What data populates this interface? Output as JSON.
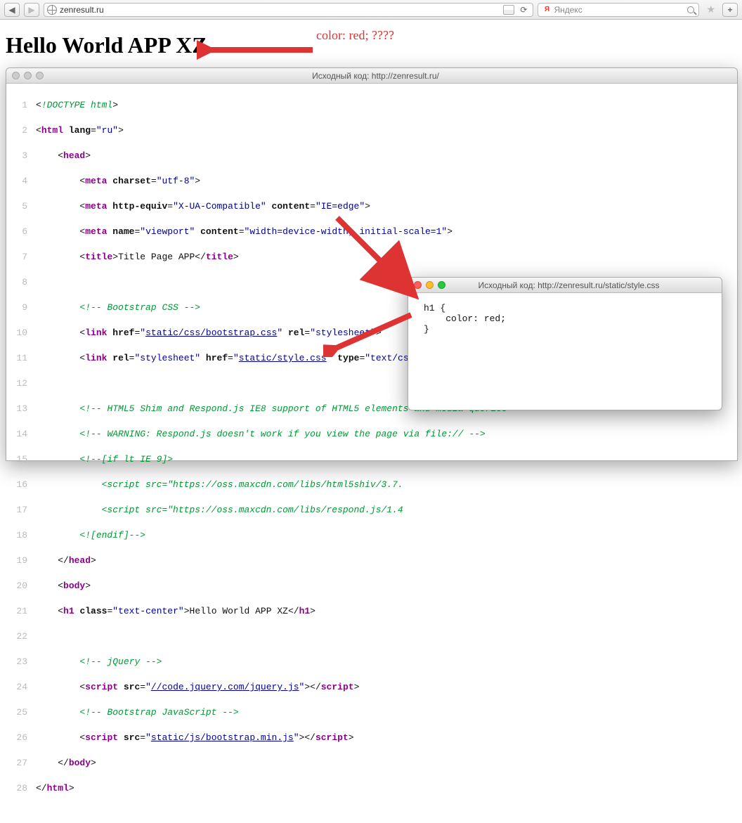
{
  "browser": {
    "url": "zenresult.ru",
    "search_placeholder": "Яндекс",
    "ya_glyph": "Я"
  },
  "page": {
    "heading": "Hello World APP XZ",
    "annotation": "color: red; ????"
  },
  "src_window": {
    "title": "Исходный код: http://zenresult.ru/"
  },
  "css_window": {
    "title": "Исходный код: http://zenresult.ru/static/style.css",
    "content": "h1 {\n    color: red;\n}"
  },
  "code": {
    "l1_com": "!DOCTYPE html",
    "l2_tag": "html",
    "l2_attr": "lang",
    "l2_val": "\"ru\"",
    "l3_tag": "head",
    "l4_tag": "meta",
    "l4_a1": "charset",
    "l4_v1": "\"utf-8\"",
    "l5_tag": "meta",
    "l5_a1": "http-equiv",
    "l5_v1": "\"X-UA-Compatible\"",
    "l5_a2": "content",
    "l5_v2": "\"IE=edge\"",
    "l6_tag": "meta",
    "l6_a1": "name",
    "l6_v1": "\"viewport\"",
    "l6_a2": "content",
    "l6_v2": "\"width=device-width, initial-scale=1\"",
    "l7_tag": "title",
    "l7_text": "Title Page APP",
    "l9_com": " Bootstrap CSS ",
    "l10_tag": "link",
    "l10_a1": "href",
    "l10_v1": "static/css/bootstrap.css",
    "l10_a2": "rel",
    "l10_v2": "\"stylesheet\"",
    "l11_tag": "link",
    "l11_a1": "rel",
    "l11_v1": "\"stylesheet\"",
    "l11_a2": "href",
    "l11_v2": "static/style.css",
    "l11_a3": "type",
    "l11_v3": "\"text/css\"",
    "l13_com": " HTML5 Shim and Respond.js IE8 support of HTML5 elements and media queries ",
    "l14_com": " WARNING: Respond.js doesn't work if you view the page via file:// ",
    "l15_com": "[if lt IE 9]",
    "l16_com": "    <script src=\"https://oss.maxcdn.com/libs/html5shiv/3.7.",
    "l17_com": "    <script src=\"https://oss.maxcdn.com/libs/respond.js/1.4",
    "l18_com": "[endif]",
    "l19_tag": "head",
    "l20_tag": "body",
    "l21_tag": "h1",
    "l21_a1": "class",
    "l21_v1": "\"text-center\"",
    "l21_text": "Hello World APP XZ",
    "l23_com": " jQuery ",
    "l24_tag": "script",
    "l24_a1": "src",
    "l24_v1": "//code.jquery.com/jquery.js",
    "l25_com": " Bootstrap JavaScript ",
    "l26_tag": "script",
    "l26_a1": "src",
    "l26_v1": "static/js/bootstrap.min.js",
    "l27_tag": "body",
    "l28_tag": "html"
  }
}
